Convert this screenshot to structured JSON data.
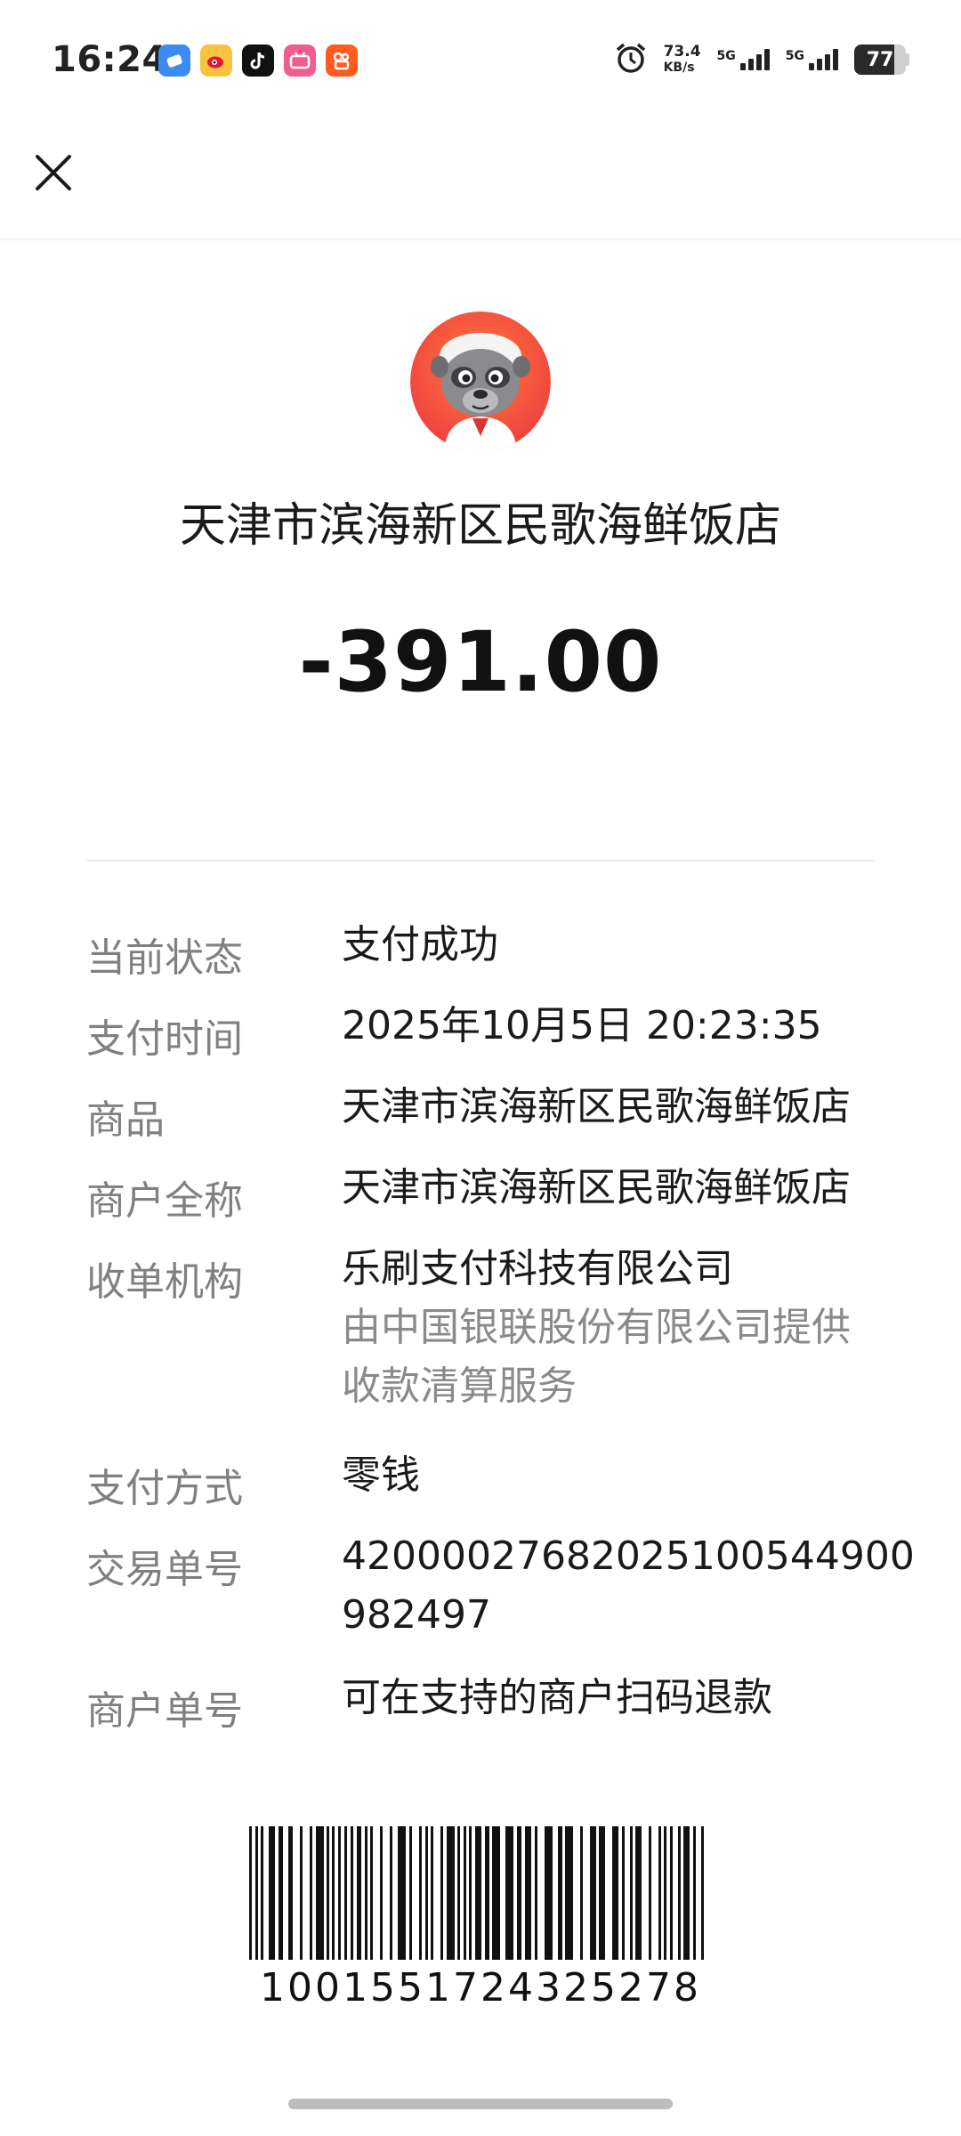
{
  "status_bar": {
    "time": "16:24",
    "net_speed_value": "73.4",
    "net_speed_unit": "KB/s",
    "signal1_label": "5G",
    "signal2_label": "5G",
    "battery_percent": "77",
    "battery_level": 0.77,
    "notification_icons": [
      "app-drawer-icon",
      "weibo-icon",
      "tiktok-icon",
      "bilibili-icon",
      "kuaishou-icon"
    ]
  },
  "merchant": {
    "name": "天津市滨海新区民歌海鲜饭店",
    "amount": "-391.00",
    "avatar_colors": [
      "#f0413f",
      "#ff7a3b"
    ]
  },
  "details": [
    {
      "label": "当前状态",
      "value_lines": [
        "支付成功"
      ],
      "sub_lines": []
    },
    {
      "label": "支付时间",
      "value_lines": [
        "2025年10月5日 20:23:35"
      ],
      "sub_lines": []
    },
    {
      "label": "商品",
      "value_lines": [
        "天津市滨海新区民歌海鲜饭店"
      ],
      "sub_lines": []
    },
    {
      "label": "商户全称",
      "value_lines": [
        "天津市滨海新区民歌海鲜饭店"
      ],
      "sub_lines": []
    },
    {
      "label": "收单机构",
      "value_lines": [
        "乐刷支付科技有限公司"
      ],
      "sub_lines": [
        "由中国银联股份有限公司提供",
        "收款清算服务"
      ]
    },
    {
      "label": "支付方式",
      "value_lines": [
        "零钱"
      ],
      "sub_lines": []
    },
    {
      "label": "交易单号",
      "value_lines": [
        "42000027682025100544900",
        "982497"
      ],
      "sub_lines": []
    },
    {
      "label": "商户单号",
      "value_lines": [
        "可在支持的商户扫码退款"
      ],
      "sub_lines": []
    }
  ],
  "barcode": {
    "number": "1001551724325278"
  }
}
